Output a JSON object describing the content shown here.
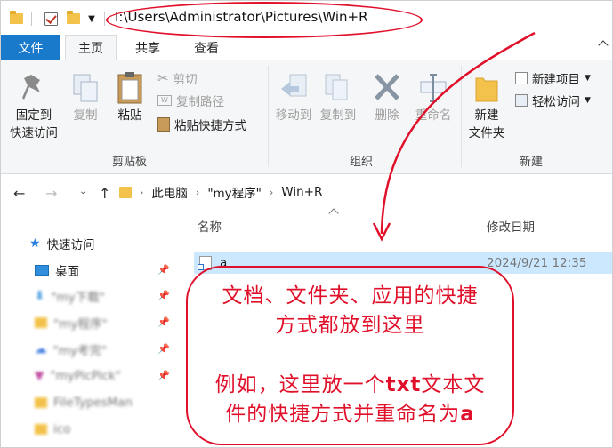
{
  "title_bar": {
    "path": "I:\\Users\\Administrator\\Pictures\\Win+R"
  },
  "tabs": [
    {
      "label": "文件"
    },
    {
      "label": "主页"
    },
    {
      "label": "共享"
    },
    {
      "label": "查看"
    }
  ],
  "ribbon": {
    "clipboard": {
      "pin_label_1": "固定到",
      "pin_label_2": "快速访问",
      "copy_label": "复制",
      "paste_label": "粘贴",
      "cut_label": "剪切",
      "copy_path_label": "复制路径",
      "paste_shortcut_label": "粘贴快捷方式",
      "group_label": "剪贴板"
    },
    "organize": {
      "move_to_label": "移动到",
      "copy_to_label": "复制到",
      "delete_label": "删除",
      "rename_label": "重命名",
      "group_label": "组织"
    },
    "new": {
      "new_folder_label_1": "新建",
      "new_folder_label_2": "文件夹",
      "new_item_label": "新建项目",
      "easy_access_label": "轻松访问",
      "group_label": "新建"
    }
  },
  "address_bar": {
    "crumb_1": "此电脑",
    "crumb_2": "\"my程序\"",
    "crumb_3": "Win+R"
  },
  "nav_pane": {
    "quick_access": "快速访问",
    "items": [
      {
        "label": "桌面"
      },
      {
        "label": "\"my下载\""
      },
      {
        "label": "\"my程序\""
      },
      {
        "label": "\"my考完\""
      },
      {
        "label": "\"myPicPick\""
      },
      {
        "label": "FileTypesMan"
      },
      {
        "label": "ico"
      }
    ]
  },
  "file_list": {
    "col_name": "名称",
    "col_date": "修改日期",
    "rows": [
      {
        "name": "a",
        "date": "2024/9/21 12:35"
      }
    ]
  },
  "annotation": {
    "line_1": "文档、文件夹、应用的快捷",
    "line_2": "方式都放到这里",
    "line_3_pre": "例如，这里放一个",
    "line_3_bold": "txt",
    "line_3_post": "文本文",
    "line_4_pre": "件的快捷方式并重命名为",
    "line_4_bold": "a"
  },
  "colors": {
    "accent": "#1979ca",
    "annotation": "#e0102a",
    "selection": "#cce8ff",
    "folder": "#f3c24a"
  }
}
